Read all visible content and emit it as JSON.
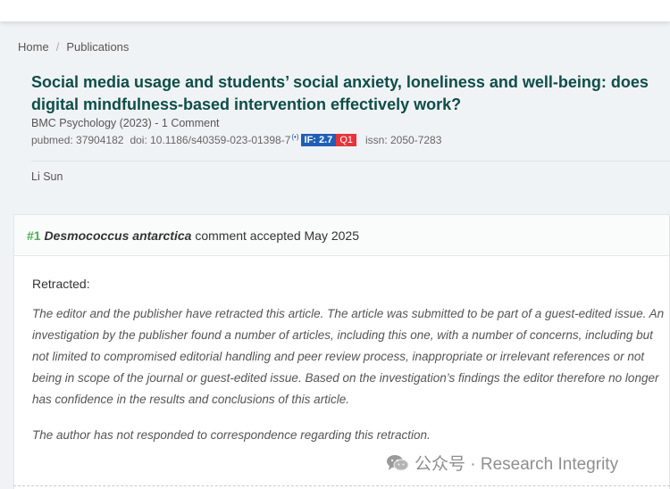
{
  "breadcrumb": {
    "home": "Home",
    "separator": "/",
    "current": "Publications"
  },
  "article": {
    "title": "Social media usage and students’ social anxiety, loneliness and well-being: does digital mindfulness-based intervention effectively work?",
    "journal": "BMC Psychology (2023)",
    "journal_sep": " - ",
    "comments": "1 Comment",
    "pubmed": "pubmed: 37904182",
    "doi": "doi: 10.1186/s40359-023-01398-7",
    "altmetric_glyph": "(•)",
    "impact_factor": "IF: 2.7",
    "quartile": "Q1",
    "issn": "issn: 2050-7283",
    "author": "Li Sun"
  },
  "comment": {
    "number": "#1",
    "commenter": "Desmococcus antarctica",
    "status": "comment accepted May 2025",
    "heading": "Retracted:",
    "paragraph1": "The editor and the publisher have retracted this article. The article was submitted to be part of a guest-edited issue. An investigation by the publisher found a number of articles, including this one, with a number of concerns, including but not limited to compromised editorial handling and peer review process, inappropriate or irrelevant references or not being in scope of the journal or guest-edited issue. Based on the investigation’s findings the editor therefore no longer has confidence in the results and conclusions of this article.",
    "paragraph2": "The author has not responded to correspondence regarding this retraction."
  },
  "watermark": {
    "icon": "wechat-icon",
    "text": "公众号 · Research Integrity"
  },
  "colors": {
    "title": "#0e4d4a",
    "if_badge": "#1f5fb5",
    "quartile_badge": "#e8333a",
    "comment_number": "#4caf50"
  }
}
